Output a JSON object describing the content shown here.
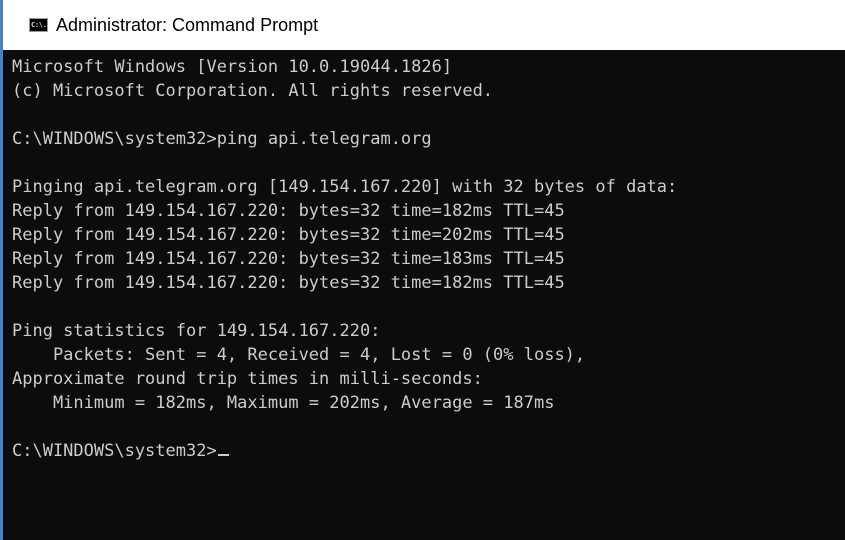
{
  "window": {
    "title": "Administrator: Command Prompt",
    "icon": "command-prompt-icon",
    "icon_text": "C:\\."
  },
  "console": {
    "lines": [
      "Microsoft Windows [Version 10.0.19044.1826]",
      "(c) Microsoft Corporation. All rights reserved.",
      "",
      "C:\\WINDOWS\\system32>ping api.telegram.org",
      "",
      "Pinging api.telegram.org [149.154.167.220] with 32 bytes of data:",
      "Reply from 149.154.167.220: bytes=32 time=182ms TTL=45",
      "Reply from 149.154.167.220: bytes=32 time=202ms TTL=45",
      "Reply from 149.154.167.220: bytes=32 time=183ms TTL=45",
      "Reply from 149.154.167.220: bytes=32 time=182ms TTL=45",
      "",
      "Ping statistics for 149.154.167.220:",
      "    Packets: Sent = 4, Received = 4, Lost = 0 (0% loss),",
      "Approximate round trip times in milli-seconds:",
      "    Minimum = 182ms, Maximum = 202ms, Average = 187ms",
      "",
      "C:\\WINDOWS\\system32>"
    ]
  },
  "colors": {
    "console_background": "#0c0c0c",
    "console_text": "#cccccc",
    "title_bar_background": "#ffffff",
    "accent": "#4a7fc1"
  }
}
